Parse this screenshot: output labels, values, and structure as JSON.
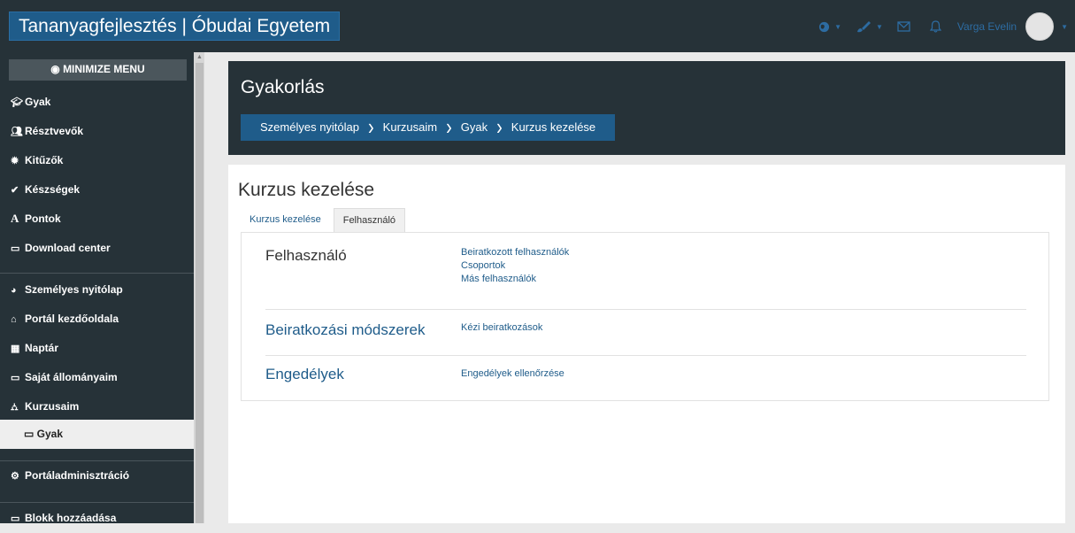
{
  "header": {
    "brand": "Tananyagfejlesztés | Óbudai Egyetem",
    "user_name": "Varga Evelin"
  },
  "icons": {
    "language": "globe-icon",
    "theme": "brush-icon",
    "messages": "envelope-icon",
    "notifications": "bell-icon"
  },
  "sidebar": {
    "minimize_label": "MINIMIZE MENU",
    "items": [
      {
        "label": "Gyak",
        "icon": "graduation-cap-icon"
      },
      {
        "label": "Résztvevők",
        "icon": "users-icon"
      },
      {
        "label": "Kitűzők",
        "icon": "badge-icon"
      },
      {
        "label": "Készségek",
        "icon": "check-circle-icon"
      },
      {
        "label": "Pontok",
        "icon": "grades-icon"
      },
      {
        "label": "Download center",
        "icon": "folder-icon"
      },
      {
        "label": "Személyes nyitólap",
        "icon": "dashboard-icon"
      },
      {
        "label": "Portál kezdőoldala",
        "icon": "home-icon"
      },
      {
        "label": "Naptár",
        "icon": "calendar-icon"
      },
      {
        "label": "Saját állományaim",
        "icon": "folder-icon"
      },
      {
        "label": "Kurzusaim",
        "icon": "sitemap-icon"
      },
      {
        "label": "Gyak",
        "icon": "folder-icon"
      },
      {
        "label": "Portáladminisztráció",
        "icon": "cogs-icon"
      },
      {
        "label": "Blokk hozzáadása",
        "icon": "folder-icon"
      }
    ]
  },
  "page": {
    "title": "Gyakorlás",
    "breadcrumb": [
      "Személyes nyitólap",
      "Kurzusaim",
      "Gyak",
      "Kurzus kezelése"
    ],
    "section_title": "Kurzus kezelése",
    "tabs": [
      "Kurzus kezelése",
      "Felhasználó"
    ],
    "rows": [
      {
        "title": "Felhasználó",
        "links": [
          "Beiratkozott felhasználók",
          "Csoportok",
          "Más felhasználók"
        ]
      },
      {
        "title": "Beiratkozási módszerek",
        "links": [
          "Kézi beiratkozások"
        ]
      },
      {
        "title": "Engedélyek",
        "links": [
          "Engedélyek ellenőrzése"
        ]
      }
    ]
  },
  "colors": {
    "dark": "#263238",
    "accent": "#1f5c8a"
  }
}
